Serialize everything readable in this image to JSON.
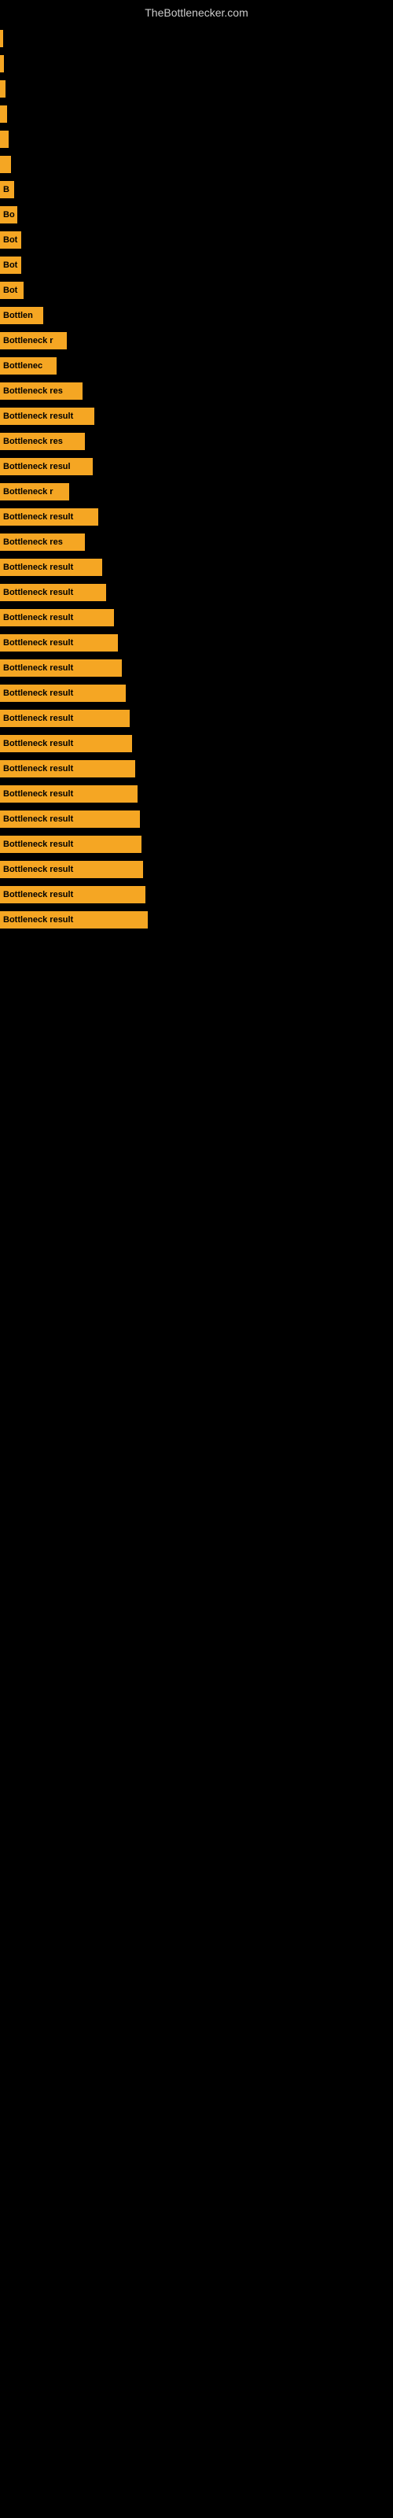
{
  "header": {
    "title": "TheBottlenecker.com"
  },
  "bars": [
    {
      "label": "",
      "width": 3
    },
    {
      "label": "",
      "width": 5
    },
    {
      "label": "",
      "width": 7
    },
    {
      "label": "",
      "width": 9
    },
    {
      "label": "",
      "width": 11
    },
    {
      "label": "",
      "width": 14
    },
    {
      "label": "B",
      "width": 18
    },
    {
      "label": "Bo",
      "width": 22
    },
    {
      "label": "Bot",
      "width": 27
    },
    {
      "label": "Bot",
      "width": 27
    },
    {
      "label": "Bot",
      "width": 30
    },
    {
      "label": "Bottlen",
      "width": 55
    },
    {
      "label": "Bottleneck r",
      "width": 85
    },
    {
      "label": "Bottlenec",
      "width": 72
    },
    {
      "label": "Bottleneck res",
      "width": 105
    },
    {
      "label": "Bottleneck result",
      "width": 120
    },
    {
      "label": "Bottleneck res",
      "width": 108
    },
    {
      "label": "Bottleneck resul",
      "width": 118
    },
    {
      "label": "Bottleneck r",
      "width": 88
    },
    {
      "label": "Bottleneck result",
      "width": 125
    },
    {
      "label": "Bottleneck res",
      "width": 108
    },
    {
      "label": "Bottleneck result",
      "width": 130
    },
    {
      "label": "Bottleneck result",
      "width": 135
    },
    {
      "label": "Bottleneck result",
      "width": 145
    },
    {
      "label": "Bottleneck result",
      "width": 150
    },
    {
      "label": "Bottleneck result",
      "width": 155
    },
    {
      "label": "Bottleneck result",
      "width": 160
    },
    {
      "label": "Bottleneck result",
      "width": 165
    },
    {
      "label": "Bottleneck result",
      "width": 168
    },
    {
      "label": "Bottleneck result",
      "width": 172
    },
    {
      "label": "Bottleneck result",
      "width": 175
    },
    {
      "label": "Bottleneck result",
      "width": 178
    },
    {
      "label": "Bottleneck result",
      "width": 180
    },
    {
      "label": "Bottleneck result",
      "width": 182
    },
    {
      "label": "Bottleneck result",
      "width": 185
    },
    {
      "label": "Bottleneck result",
      "width": 188
    }
  ]
}
